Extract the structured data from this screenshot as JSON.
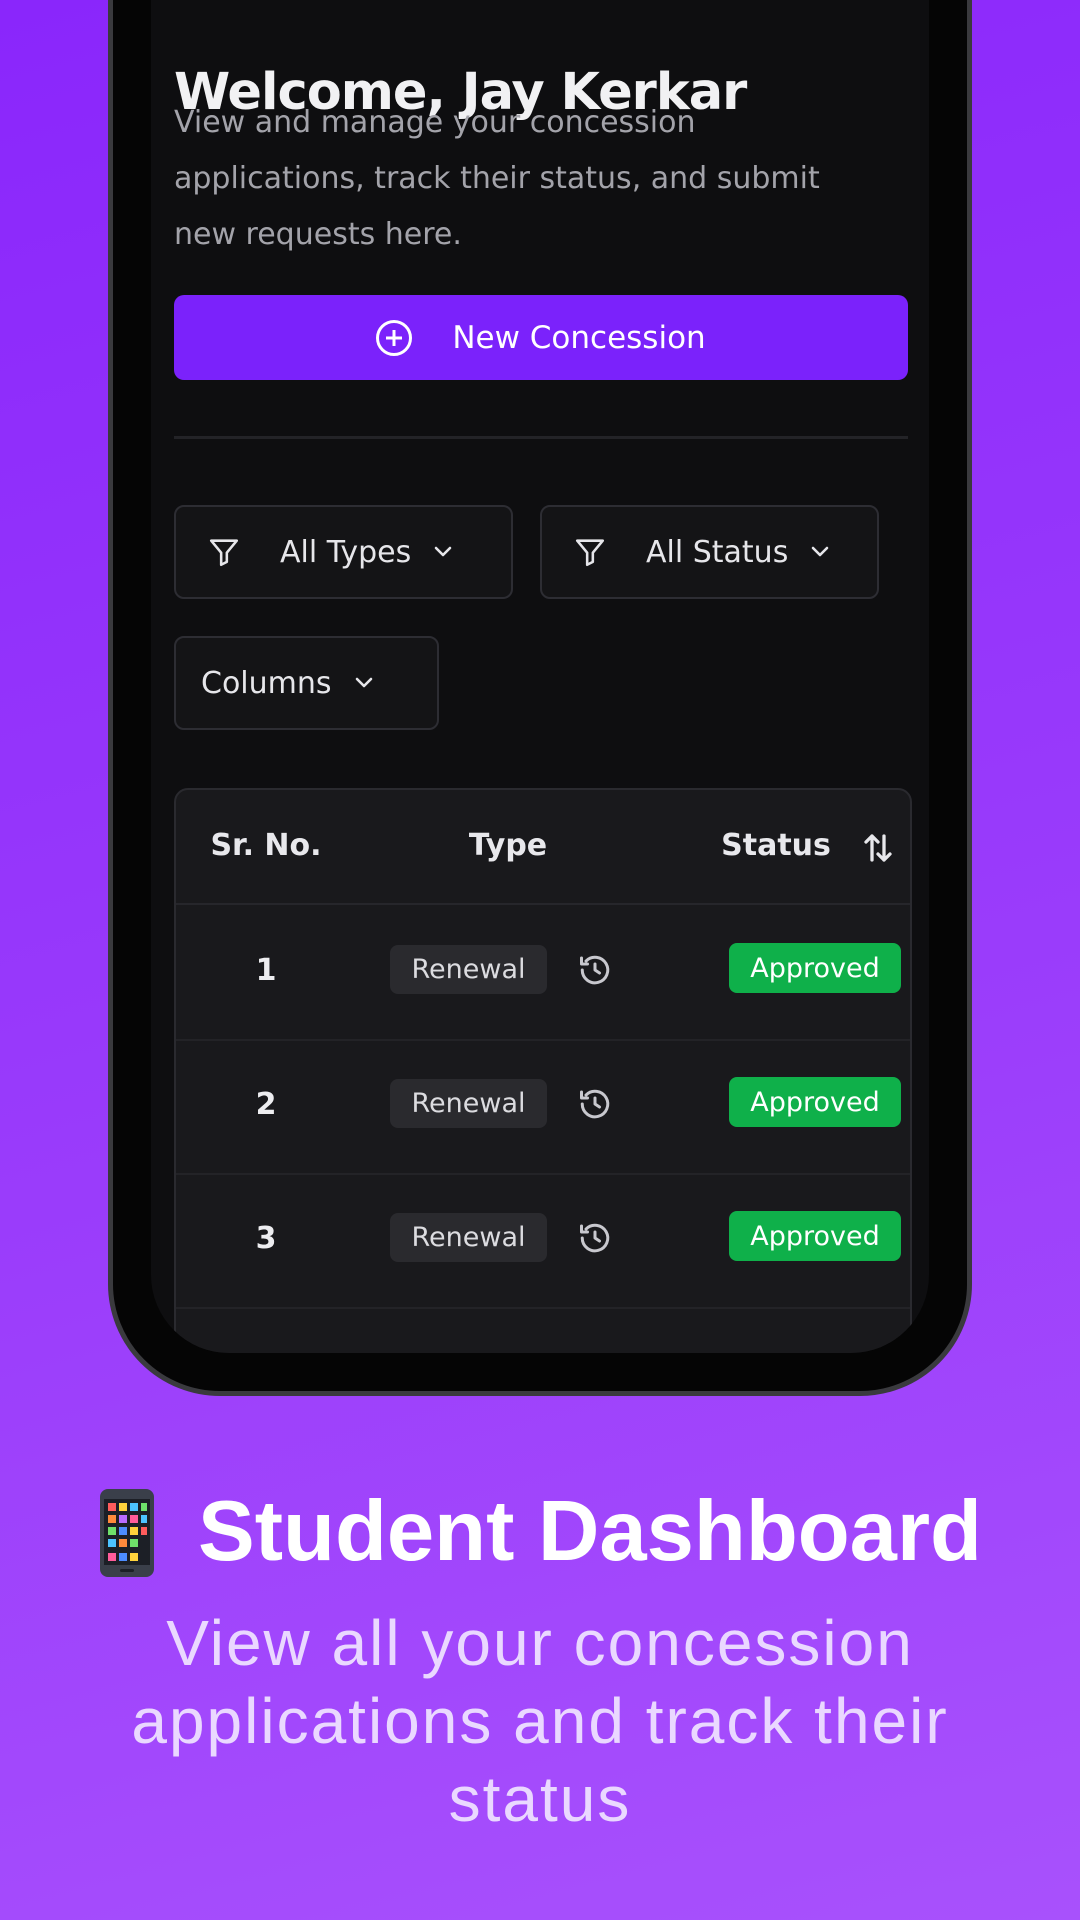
{
  "dashboard": {
    "welcome_title": "Welcome, Jay Kerkar",
    "description": "View and manage your concession applications, track their status, and submit new requests here.",
    "new_concession_label": "New Concession",
    "filters": {
      "types_label": "All Types",
      "status_label": "All Status",
      "columns_label": "Columns"
    },
    "table": {
      "headers": {
        "sr_no": "Sr. No.",
        "type": "Type",
        "status": "Status"
      },
      "rows": [
        {
          "sr_no": "1",
          "type": "Renewal",
          "status": "Approved"
        },
        {
          "sr_no": "2",
          "type": "Renewal",
          "status": "Approved"
        },
        {
          "sr_no": "3",
          "type": "Renewal",
          "status": "Approved"
        }
      ]
    }
  },
  "caption": {
    "title": "Student Dashboard",
    "icon": "mobile-phone-icon",
    "subtitle": "View all your concession applications and track their status"
  },
  "colors": {
    "accent": "#7b22fb",
    "approved": "#0fb04a",
    "background_top": "#8a26fb",
    "background_bottom": "#a851fc"
  }
}
